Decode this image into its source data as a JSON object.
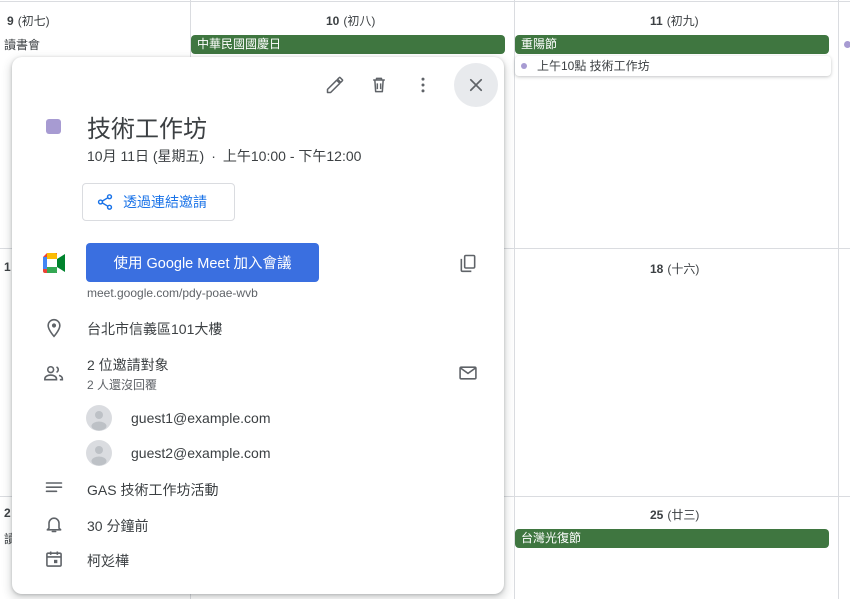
{
  "calendar": {
    "days": [
      {
        "num": "9",
        "lunar": "(初七)"
      },
      {
        "num": "10",
        "lunar": "(初八)"
      },
      {
        "num": "11",
        "lunar": "(初九)"
      },
      {
        "num": "1",
        "lunar": ""
      },
      {
        "num": "18",
        "lunar": "(十六)"
      },
      {
        "num": "2",
        "lunar": ""
      },
      {
        "num": "25",
        "lunar": "(廿三)"
      }
    ],
    "events": {
      "reading_club": "讀書會",
      "reading_club_partial": "讀",
      "national_day": "中華民國國慶日",
      "double_ninth": "重陽節",
      "workshop_chip": "上午10點 技術工作坊",
      "retrocession_day": "台灣光復節"
    },
    "colors": {
      "holiday": "#3f7640",
      "event": "#a79bd2"
    }
  },
  "popup": {
    "toolbar": {
      "edit_icon": "pencil-icon",
      "delete_icon": "trash-icon",
      "more_icon": "more-vert-icon",
      "close_icon": "close-icon"
    },
    "title": "技術工作坊",
    "date": "10月 11日 (星期五)",
    "separator": "·",
    "time": "上午10:00 - 下午12:00",
    "invite_link_label": "透過連結邀請",
    "meet_button_label": "使用 Google Meet 加入會議",
    "meet_url": "meet.google.com/pdy-poae-wvb",
    "location": "台北市信義區101大樓",
    "guests_title": "2 位邀請對象",
    "guests_subtitle": "2 人還沒回覆",
    "guests": [
      "guest1@example.com",
      "guest2@example.com"
    ],
    "description": "GAS 技術工作坊活動",
    "reminder": "30 分鐘前",
    "organizer": "柯彣樺",
    "accent_color": "#1a73e8",
    "meet_button_color": "#3a6fe0"
  }
}
